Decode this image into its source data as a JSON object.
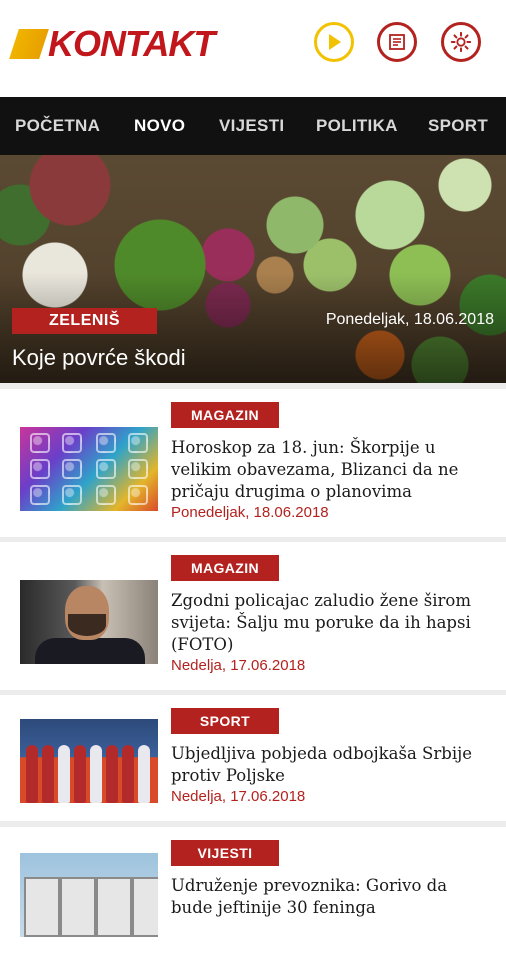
{
  "app": {
    "logo_text": "KONTAKT"
  },
  "colors": {
    "brand_red": "#b3221e",
    "accent_yellow": "#f2c200",
    "nav_bg": "#111111"
  },
  "header_icons": [
    "play-icon",
    "list-icon",
    "gear-icon"
  ],
  "nav": {
    "items": [
      "POČETNA",
      "NOVO",
      "VIJESTI",
      "POLITIKA",
      "SPORT"
    ],
    "active": "NOVO"
  },
  "hero": {
    "category": "ZELENIŠ",
    "date": "Ponedeljak, 18.06.2018",
    "title": "Koje povrće škodi"
  },
  "articles": [
    {
      "category": "MAGAZIN",
      "title": "Horoskop za 18. jun: Škorpije u velikim obavezama, Blizanci da ne pričaju drugima o planovima",
      "date": "Ponedeljak, 18.06.2018"
    },
    {
      "category": "MAGAZIN",
      "title": "Zgodni policajac zaludio žene širom svijeta: Šalju mu poruke da ih hapsi (FOTO)",
      "date": "Nedelja, 17.06.2018"
    },
    {
      "category": "SPORT",
      "title": "Ubjedljiva pobjeda odbojkaša Srbije protiv Poljske",
      "date": "Nedelja, 17.06.2018"
    },
    {
      "category": "VIJESTI",
      "title": "Udruženje prevoznika: Gorivo da bude jeftinije 30 feninga",
      "date": ""
    }
  ]
}
